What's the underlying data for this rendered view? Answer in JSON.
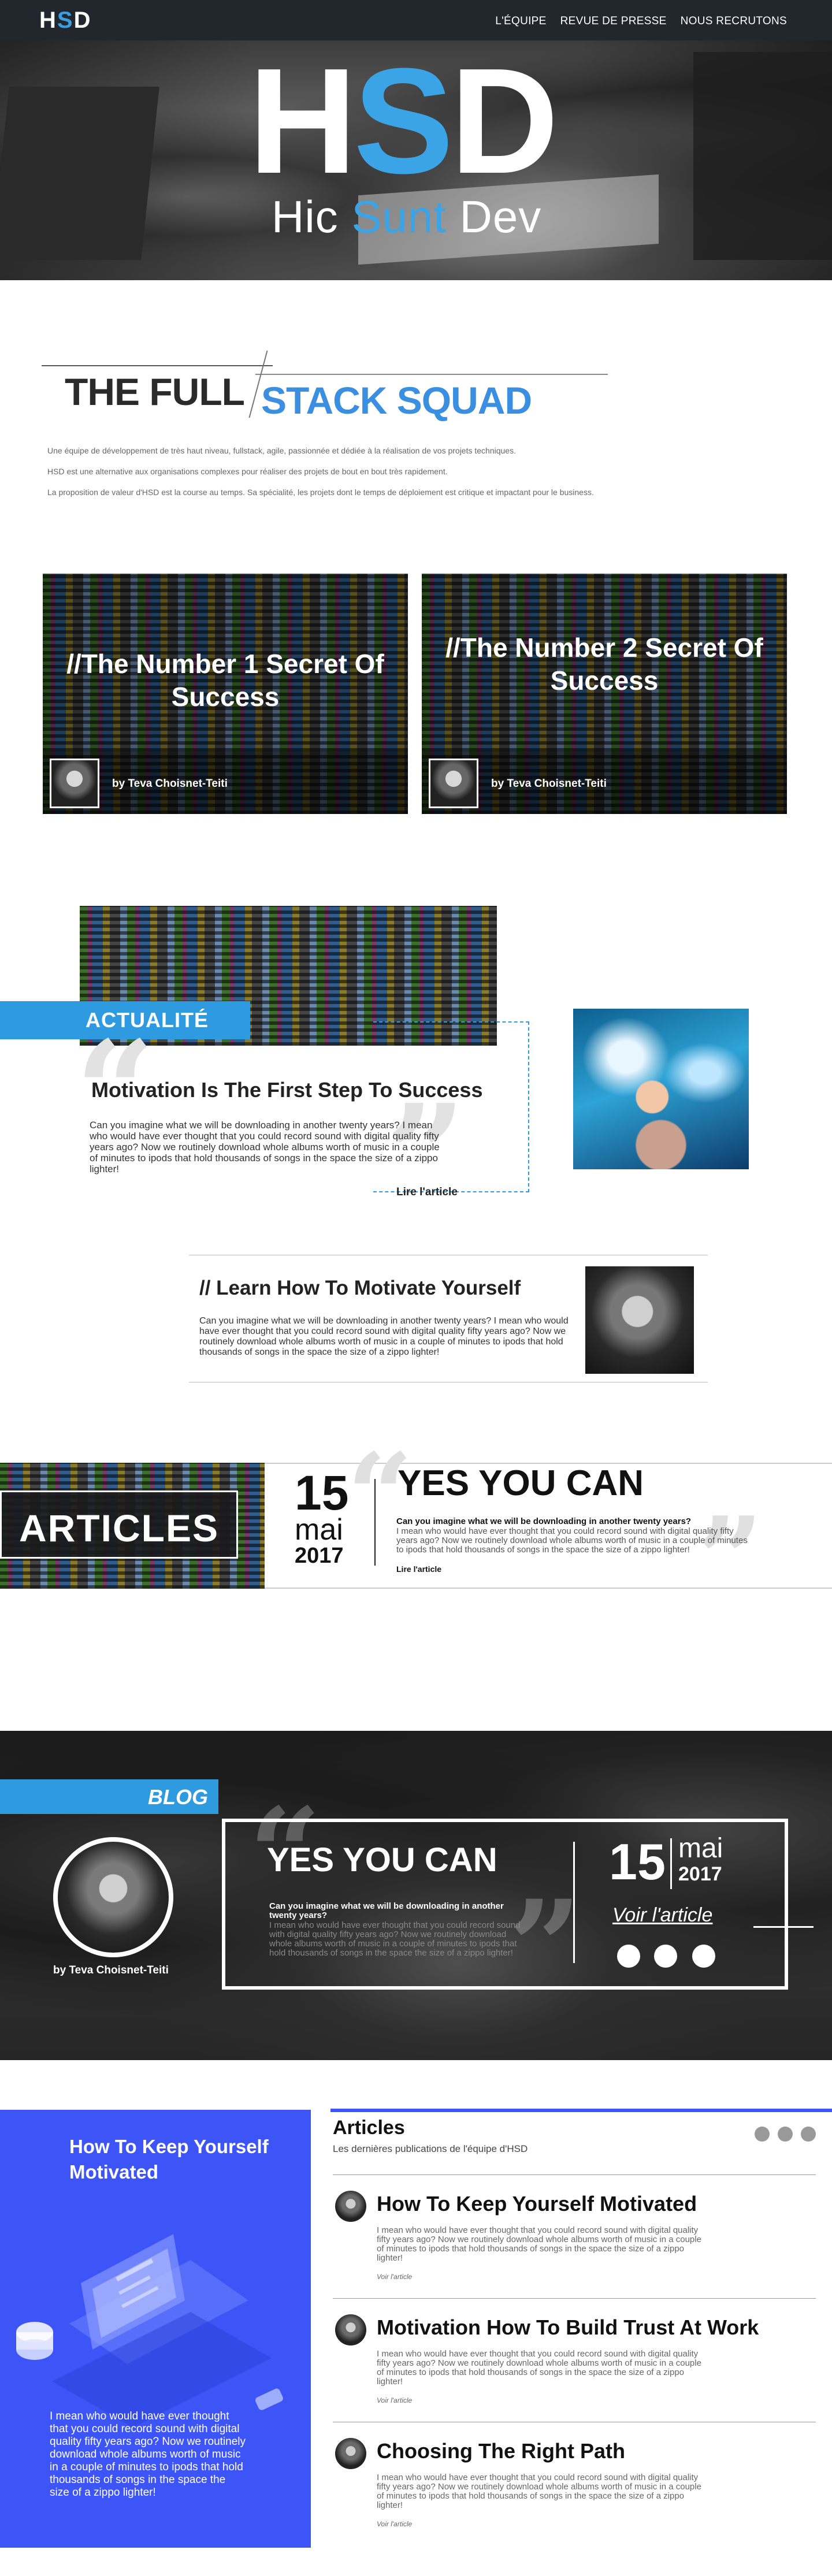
{
  "nav": {
    "logo_h": "H",
    "logo_s": "S",
    "logo_d": "D",
    "menu": [
      "L'ÉQUIPE",
      "REVUE DE PRESSE",
      "NOUS RECRUTONS"
    ]
  },
  "hero": {
    "big_h": "H",
    "big_s": "S",
    "big_d": "D",
    "sub_hic": "Hic",
    "sub_sunt": "Sunt",
    "sub_dev": "Dev"
  },
  "fullstack": {
    "title_part1": "THE FULL",
    "title_part2": "STACK SQUAD",
    "paragraphs": [
      "Une équipe de développement de très haut niveau, fullstack, agile, passionnée et dédiée à la réalisation de vos projets techniques.",
      "HSD est une alternative aux organisations complexes pour réaliser des projets de bout en bout très rapidement.",
      "La proposition de valeur d'HSD est la course au temps.  Sa spécialité, les projets dont le temps de déploiement est critique et impactant pour le business."
    ]
  },
  "cards": [
    {
      "title": "//The Number 1 Secret Of Success",
      "author": "by Teva Choisnet-Teiti"
    },
    {
      "title": "//The Number 2 Secret Of Success",
      "author": "by Teva Choisnet-Teiti"
    }
  ],
  "actualite": {
    "badge": "ACTUALITÉ",
    "title": "Motivation Is The First Step To Success",
    "text": "Can you imagine what we will be downloading in another twenty years? I mean who would have ever thought that you could record sound with digital quality fifty years ago? Now we routinely download whole albums worth of music in a couple of minutes to ipods that hold thousands of songs in the space the size of a zippo lighter!",
    "link": "Lire l'article"
  },
  "learn": {
    "title": "// Learn How To Motivate Yourself",
    "text": "Can you imagine what we will be downloading in another twenty years? I mean who would have ever thought that you could record sound with digital quality fifty years ago? Now we routinely download whole albums worth of music in a couple of minutes to ipods that hold thousands of songs in the space the size of a zippo lighter!"
  },
  "articles_band": {
    "label": "ARTICLES",
    "day": "15",
    "month": "mai",
    "year": "2017",
    "title": "YES YOU CAN",
    "question": "Can you imagine what we will be downloading in another twenty years?",
    "text": "I mean who would have ever thought that you could record sound with digital quality fifty years ago? Now we routinely download whole albums worth of music in a couple of minutes to ipods that hold thousands of songs in the space the size of a zippo lighter!",
    "link": "Lire l'article"
  },
  "blog": {
    "badge": "BLOG",
    "author": "by Teva Choisnet-Teiti",
    "title": "YES YOU CAN",
    "question": "Can you imagine what we will be downloading in another twenty years?",
    "text": "I mean who would have ever thought that you could record sound with digital quality fifty years ago? Now we routinely download whole albums worth of music in a couple of minutes to ipods that hold thousands of songs in the space the size of a zippo lighter!",
    "day": "15",
    "month": "mai",
    "year": "2017",
    "link": "Voir l'article"
  },
  "promo": {
    "title": "How To Keep Yourself Motivated",
    "text": "I mean who would have ever thought that you could record sound with digital quality fifty years ago? Now we routinely download whole albums worth of music in a couple of minutes to ipods that hold thousands of songs in the space the size of a zippo lighter!"
  },
  "articles_list": {
    "heading": "Articles",
    "subheading": "Les dernières publications de l'équipe d'HSD",
    "items": [
      {
        "title": "How To Keep Yourself Motivated",
        "text": "I mean who would have ever thought that you could record sound with digital quality fifty years ago? Now we routinely download whole albums worth of music in a couple of minutes to ipods that hold thousands of songs in the space the size of a zippo lighter!",
        "link": "Voir l'article"
      },
      {
        "title": "Motivation How To Build Trust At Work",
        "text": "I mean who would have ever thought that you could record sound with digital quality fifty years ago? Now we routinely download whole albums worth of music in a couple of minutes to ipods that hold thousands of songs in the space the size of a zippo lighter!",
        "link": "Voir l'article"
      },
      {
        "title": "Choosing The Right Path",
        "text": "I mean who would have ever thought that you could record sound with digital quality fifty years ago? Now we routinely download whole albums worth of music in a couple of minutes to ipods that hold thousands of songs in the space the size of a zippo lighter!",
        "link": "Voir l'article"
      }
    ]
  },
  "colors": {
    "accent_blue": "#2e9be0",
    "promo_blue": "#3d55f7",
    "nav_bg": "#22262d"
  }
}
